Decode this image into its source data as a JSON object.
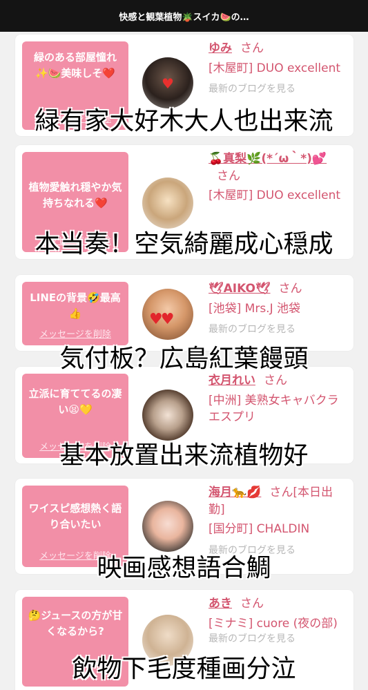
{
  "topbar": {
    "title": "快感と観葉植物🪴スイカ🍉の…"
  },
  "cards": [
    {
      "message": "緑のある部屋憧れ✨🍉美味しそ❤️",
      "delete_label": "メッセージを削除",
      "name": "ゆみ",
      "honorific": "さん",
      "shop": "[木屋町] DUO excellent",
      "blog_link": "最新のブログを見る",
      "caption": "緑有家大好木大人也出来流"
    },
    {
      "message": "植物愛触れ穏やか気持ちなれる❤️",
      "delete_label": "メッセージを削除",
      "name": "🍒真梨🌿(*´ω｀*)💕",
      "honorific": "さん",
      "shop": "[木屋町] DUO excellent",
      "blog_link": "",
      "caption": "本当奏！空気綺麗成心穏成"
    },
    {
      "message": "LINEの背景🤣最高👍",
      "delete_label": "メッセージを削除",
      "name": "🕊AIKO🕊",
      "honorific": "さん",
      "shop": "[池袋] Mrs.J 池袋",
      "blog_link": "最新のブログを見る",
      "caption": "気付板？広島紅葉饅頭"
    },
    {
      "message": "立派に育ててるの凄い😫💛",
      "delete_label": "メッセージを削除",
      "name": "衣月れい",
      "honorific": "さん",
      "shop": "[中洲] 美熟女キャバクラ エスプリ",
      "blog_link": "",
      "caption": "基本放置出来流植物好"
    },
    {
      "message": "ワイスピ感想熱く語り合いたい",
      "delete_label": "メッセージを削除",
      "name": "海月🐆💋",
      "honorific": "さん[本日出勤]",
      "shop": "[国分町] CHALDIN",
      "blog_link": "最新のブログを見る",
      "caption": "映画感想語合鯛"
    },
    {
      "message": "🤔ジュースの方が甘くなるから?",
      "delete_label": "",
      "name": "あき",
      "honorific": "さん",
      "shop": "[ミナミ] cuore (夜の部)",
      "blog_link": "最新のブログを見る",
      "caption": "飲物下毛度種画分泣"
    }
  ]
}
